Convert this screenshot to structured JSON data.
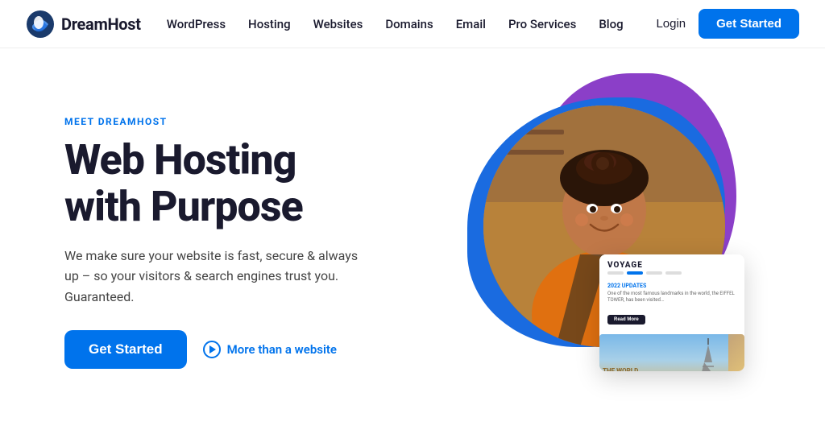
{
  "navbar": {
    "logo_text": "DreamHost",
    "nav_items": [
      {
        "label": "WordPress",
        "id": "wordpress"
      },
      {
        "label": "Hosting",
        "id": "hosting"
      },
      {
        "label": "Websites",
        "id": "websites"
      },
      {
        "label": "Domains",
        "id": "domains"
      },
      {
        "label": "Email",
        "id": "email"
      },
      {
        "label": "Pro Services",
        "id": "pro-services"
      },
      {
        "label": "Blog",
        "id": "blog"
      }
    ],
    "login_label": "Login",
    "get_started_label": "Get Started"
  },
  "hero": {
    "meet_label": "MEET DREAMHOST",
    "title_line1": "Web Hosting",
    "title_line2": "with Purpose",
    "description": "We make sure your website is fast, secure & always up – so your visitors & search engines trust you. Guaranteed.",
    "get_started_label": "Get Started",
    "more_link_label": "More than a website"
  },
  "website_card": {
    "voyage_title": "VOYAGE",
    "update_label": "2022 UPDATES",
    "update_text": "One of the most famous landmarks in the world, the EIFFEL TOWER, has been visited...",
    "read_more_label": "Read More",
    "world_text": "THE WORLD\nAROUND"
  }
}
